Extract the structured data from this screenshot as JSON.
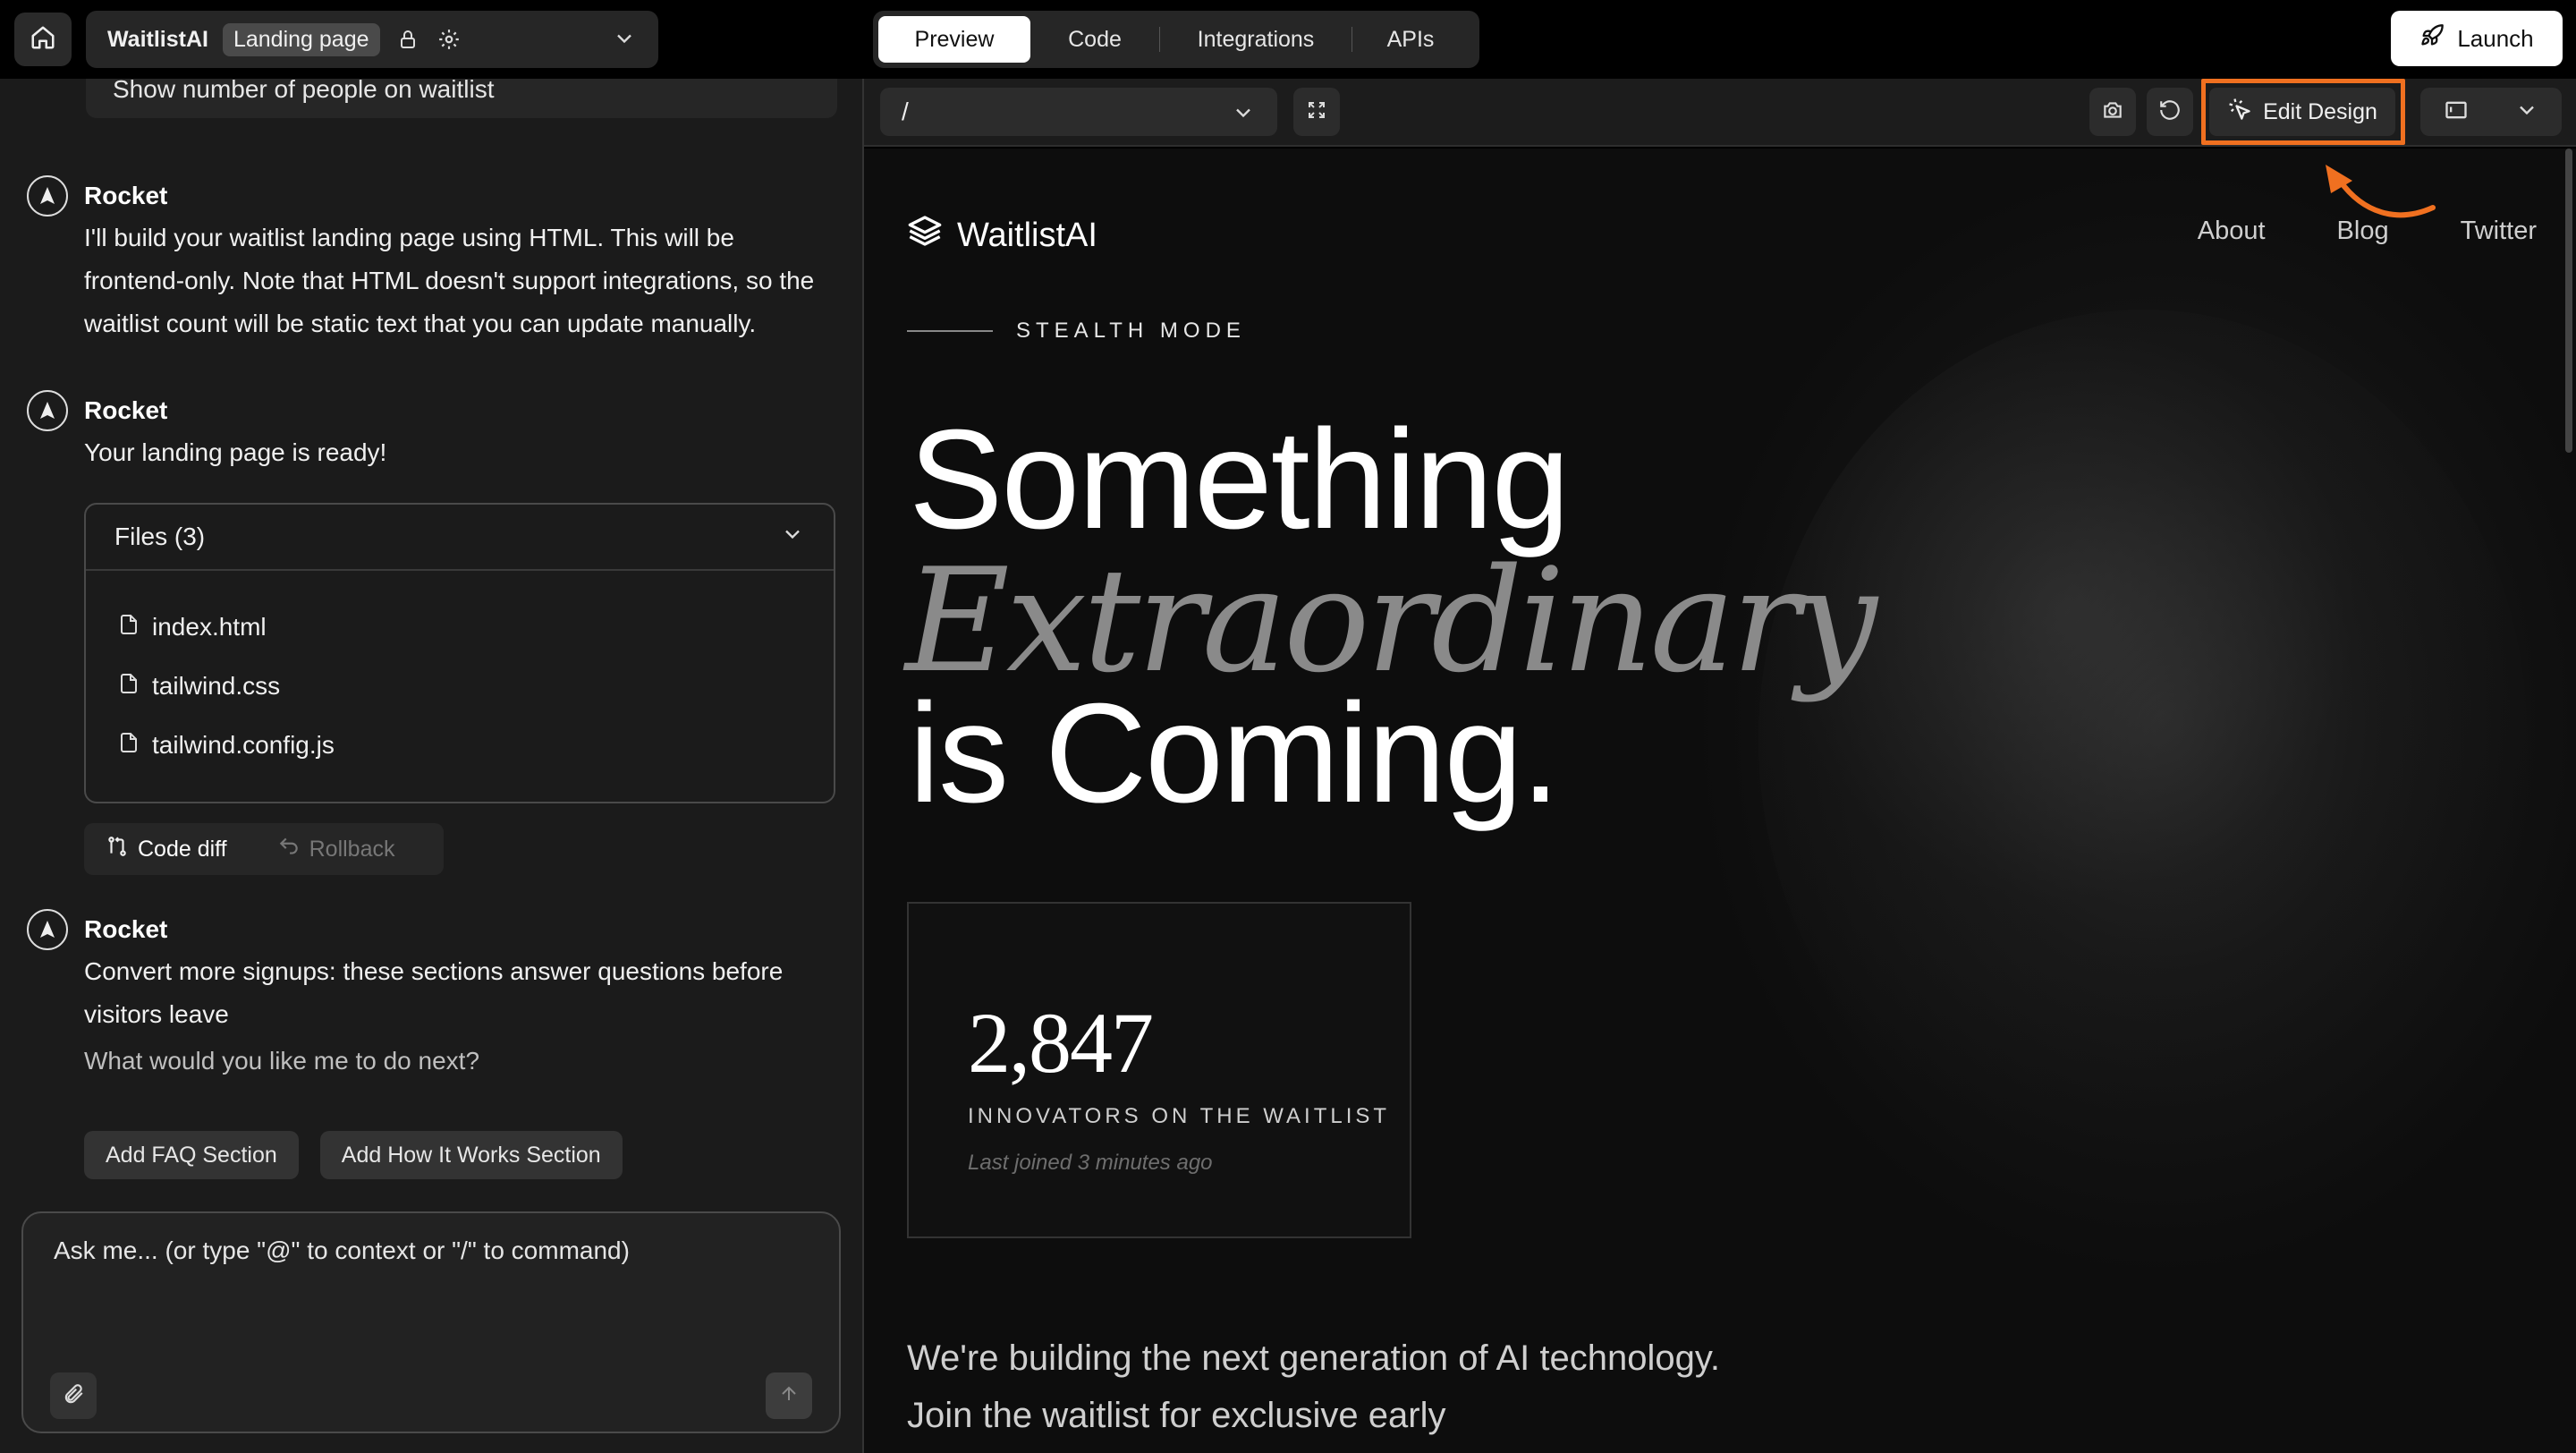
{
  "topbar": {
    "project_name": "WaitlistAI",
    "project_tag": "Landing page",
    "tabs": [
      {
        "label": "Preview"
      },
      {
        "label": "Code"
      },
      {
        "label": "Integrations"
      },
      {
        "label": "APIs"
      }
    ],
    "launch_label": "Launch"
  },
  "chat": {
    "previous_message_fragment": "Show number of people on waitlist",
    "messages": [
      {
        "sender": "Rocket",
        "text": "I'll build your waitlist landing page using HTML. This will be frontend-only. Note that HTML doesn't support integrations, so the waitlist count will be static text that you can update manually."
      },
      {
        "sender": "Rocket",
        "text": "Your landing page is ready!"
      },
      {
        "sender": "Rocket",
        "text": "Convert more signups: these sections answer questions before visitors leave",
        "followup": "What would you like me to do next?"
      }
    ],
    "files": {
      "header": "Files (3)",
      "items": [
        "index.html",
        "tailwind.css",
        "tailwind.config.js"
      ]
    },
    "actions": {
      "code_diff": "Code diff",
      "rollback": "Rollback"
    },
    "suggestions": [
      "Add FAQ Section",
      "Add How It Works Section"
    ],
    "composer": {
      "placeholder": "Ask me... (or type \"@\" to context or \"/\" to command)"
    }
  },
  "preview_toolbar": {
    "route": "/",
    "edit_design_label": "Edit Design",
    "highlight_color": "#f07020"
  },
  "site": {
    "logo_text": "WaitlistAI",
    "nav": [
      "About",
      "Blog",
      "Twitter"
    ],
    "eyebrow": "STEALTH MODE",
    "headline_line1": "Something",
    "headline_line2": "Extraordinary",
    "headline_line3": "is Coming.",
    "stat": {
      "value": "2,847",
      "label": "INNOVATORS ON THE WAITLIST",
      "sub": "Last joined 3 minutes ago"
    },
    "description": "We're building the next generation of AI technology. Join the waitlist for exclusive early"
  }
}
